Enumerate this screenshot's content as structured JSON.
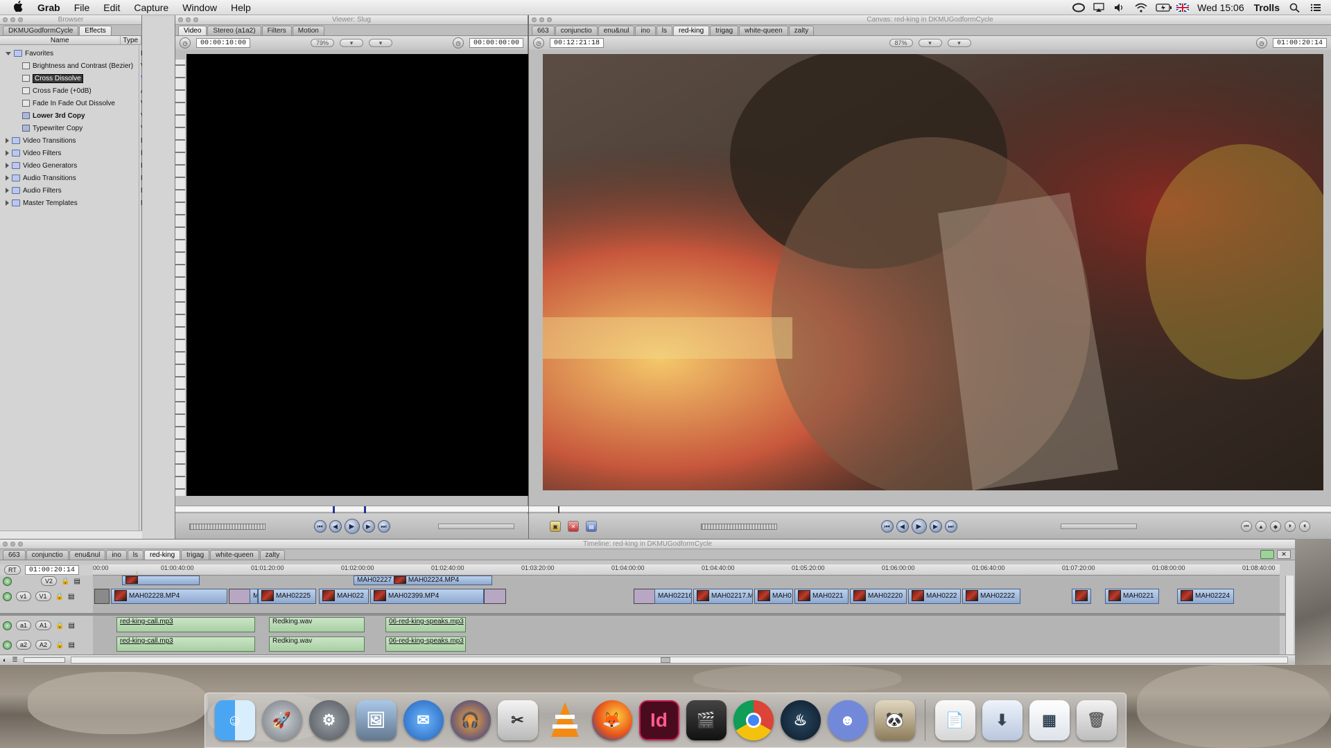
{
  "menubar": {
    "apple": "",
    "app_name": "Grab",
    "menus": [
      "File",
      "Edit",
      "Capture",
      "Window",
      "Help"
    ],
    "clock": "Wed 15:06",
    "user": "Trolls"
  },
  "browser": {
    "title": "Browser",
    "tabs": [
      "DKMUGodformCycle",
      "Effects"
    ],
    "active_tab": "Effects",
    "columns": [
      "Name",
      "Type"
    ],
    "rows": [
      {
        "name": "Favorites",
        "type": "Bin",
        "level": 0,
        "expanded": true
      },
      {
        "name": "Brightness and Contrast (Bezier)",
        "type": "Video Fi",
        "level": 1
      },
      {
        "name": "Cross Dissolve",
        "type": "Video T",
        "level": 1,
        "selected": true
      },
      {
        "name": "Cross Fade (+0dB)",
        "type": "Audio T",
        "level": 1
      },
      {
        "name": "Fade In Fade Out Dissolve",
        "type": "Video T",
        "level": 1
      },
      {
        "name": "Lower 3rd Copy",
        "type": "Video G",
        "level": 1,
        "bold": true
      },
      {
        "name": "Typewriter Copy",
        "type": "Video G",
        "level": 1
      },
      {
        "name": "Video Transitions",
        "type": "Bin",
        "level": 0
      },
      {
        "name": "Video Filters",
        "type": "Bin",
        "level": 0
      },
      {
        "name": "Video Generators",
        "type": "Bin",
        "level": 0
      },
      {
        "name": "Audio Transitions",
        "type": "Bin",
        "level": 0
      },
      {
        "name": "Audio Filters",
        "type": "Bin",
        "level": 0
      },
      {
        "name": "Master Templates",
        "type": "Bin",
        "level": 0
      }
    ]
  },
  "viewer": {
    "title": "Viewer: Slug",
    "tabs": [
      "Video",
      "Stereo (a1a2)",
      "Filters",
      "Motion"
    ],
    "active_tab": "Video",
    "duration": "00:00:10:00",
    "zoom": "79%",
    "current": "00:00:00:00"
  },
  "canvas": {
    "title": "Canvas: red-king in DKMUGodformCycle",
    "tabs": [
      "663",
      "conjunctio",
      "enu&nul",
      "ino",
      "ls",
      "red-king",
      "trigag",
      "white-queen",
      "zalty"
    ],
    "active_tab": "red-king",
    "duration": "00:12:21:18",
    "zoom": "87%",
    "current": "01:00:20:14"
  },
  "timeline": {
    "title": "Timeline: red-king in DKMUGodformCycle",
    "tabs": [
      "663",
      "conjunctio",
      "enu&nul",
      "ino",
      "ls",
      "red-king",
      "trigag",
      "white-queen",
      "zalty"
    ],
    "active_tab": "red-king",
    "rt": "RT",
    "timecode": "01:00:20:14",
    "ruler": [
      "00:00",
      "01:00:40:00",
      "01:01:20:00",
      "01:02:00:00",
      "01:02:40:00",
      "01:03:20:00",
      "01:04:00:00",
      "01:04:40:00",
      "01:05:20:00",
      "01:06:00:00",
      "01:06:40:00",
      "01:07:20:00",
      "01:08:00:00",
      "01:08:40:00"
    ],
    "tracks": {
      "v2": {
        "dest": "v2",
        "src": "V2"
      },
      "v1": {
        "dest": "v1",
        "src": "V1"
      },
      "a1": {
        "dest": "a1",
        "src": "A1"
      },
      "a2": {
        "dest": "a2",
        "src": "A2"
      }
    },
    "v2_clips": [
      "MAH02227",
      "MAH02224.MP4"
    ],
    "v1_clips": [
      "MAH02228.MP4",
      "M",
      "MAH02225",
      "MAH022",
      "MAH02399.MP4",
      "MAH02216",
      "MAH02217.M",
      "MAH0",
      "MAH0221",
      "MAH02220",
      "MAH0222",
      "MAH02222",
      "MAH0221",
      "MAH02224"
    ],
    "a1_clips": [
      "red-king-call.mp3",
      "Redking.wav",
      "06-red-king-speaks.mp3"
    ],
    "a2_clips": [
      "red-king-call.mp3",
      "Redking.wav",
      "06-red-king-speaks.mp3"
    ]
  },
  "dock": {
    "apps": [
      "finder-icon",
      "launchpad-icon",
      "system-preferences-icon",
      "preview-icon",
      "thunderbird-icon",
      "audacity-icon",
      "scissors-icon",
      "vlc-icon",
      "firefox-icon",
      "indesign-icon",
      "final-cut-icon",
      "chrome-icon",
      "steam-icon",
      "discord-icon",
      "photo-booth-icon"
    ],
    "indesign_label": "Id",
    "docs": [
      "document-icon",
      "downloads-icon",
      "preview-doc-icon",
      "trash-icon"
    ]
  },
  "colors": {
    "video_clip": "#8ea8cf",
    "audio_clip": "#a8cfa2",
    "selection": "#3a63b8",
    "indesign": "#cc1b54"
  }
}
